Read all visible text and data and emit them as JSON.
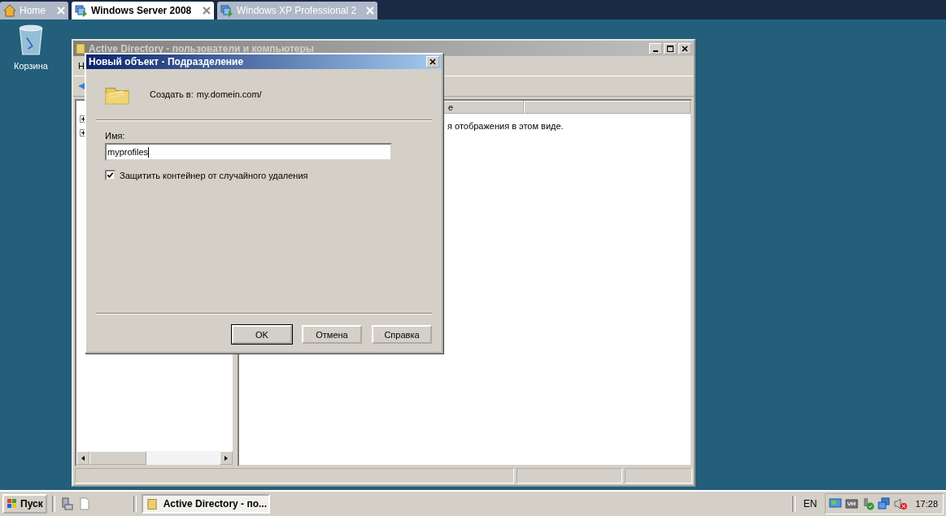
{
  "tabs": [
    {
      "label": "Home",
      "kind": "home",
      "selected": false
    },
    {
      "label": "Windows Server 2008",
      "kind": "vm",
      "selected": true
    },
    {
      "label": "Windows XP Professional 2",
      "kind": "vm",
      "selected": false
    }
  ],
  "desktop_icons": [
    {
      "label": "Корзина"
    }
  ],
  "background_window": {
    "title": "Active Directory - пользователи и компьютеры",
    "menu_fragment": "Н",
    "column_1": "е",
    "message": "я отображения в этом виде."
  },
  "dialog": {
    "title": "Новый объект - Подразделение",
    "create_in_label": "Создать в:",
    "create_in_value": "my.domein.com/",
    "name_label": "Имя:",
    "name_value": "myprofiles",
    "checkbox": {
      "label": "Защитить контейнер от случайного удаления",
      "checked": true
    },
    "buttons": [
      {
        "label": "OK",
        "default": true
      },
      {
        "label": "Отмена",
        "default": false
      },
      {
        "label": "Справка",
        "default": false
      }
    ]
  },
  "taskbar": {
    "start": "Пуск",
    "tasks": [
      {
        "label": "Active Directory - по...",
        "selected": true
      }
    ],
    "language": "EN",
    "clock": "17:28"
  }
}
